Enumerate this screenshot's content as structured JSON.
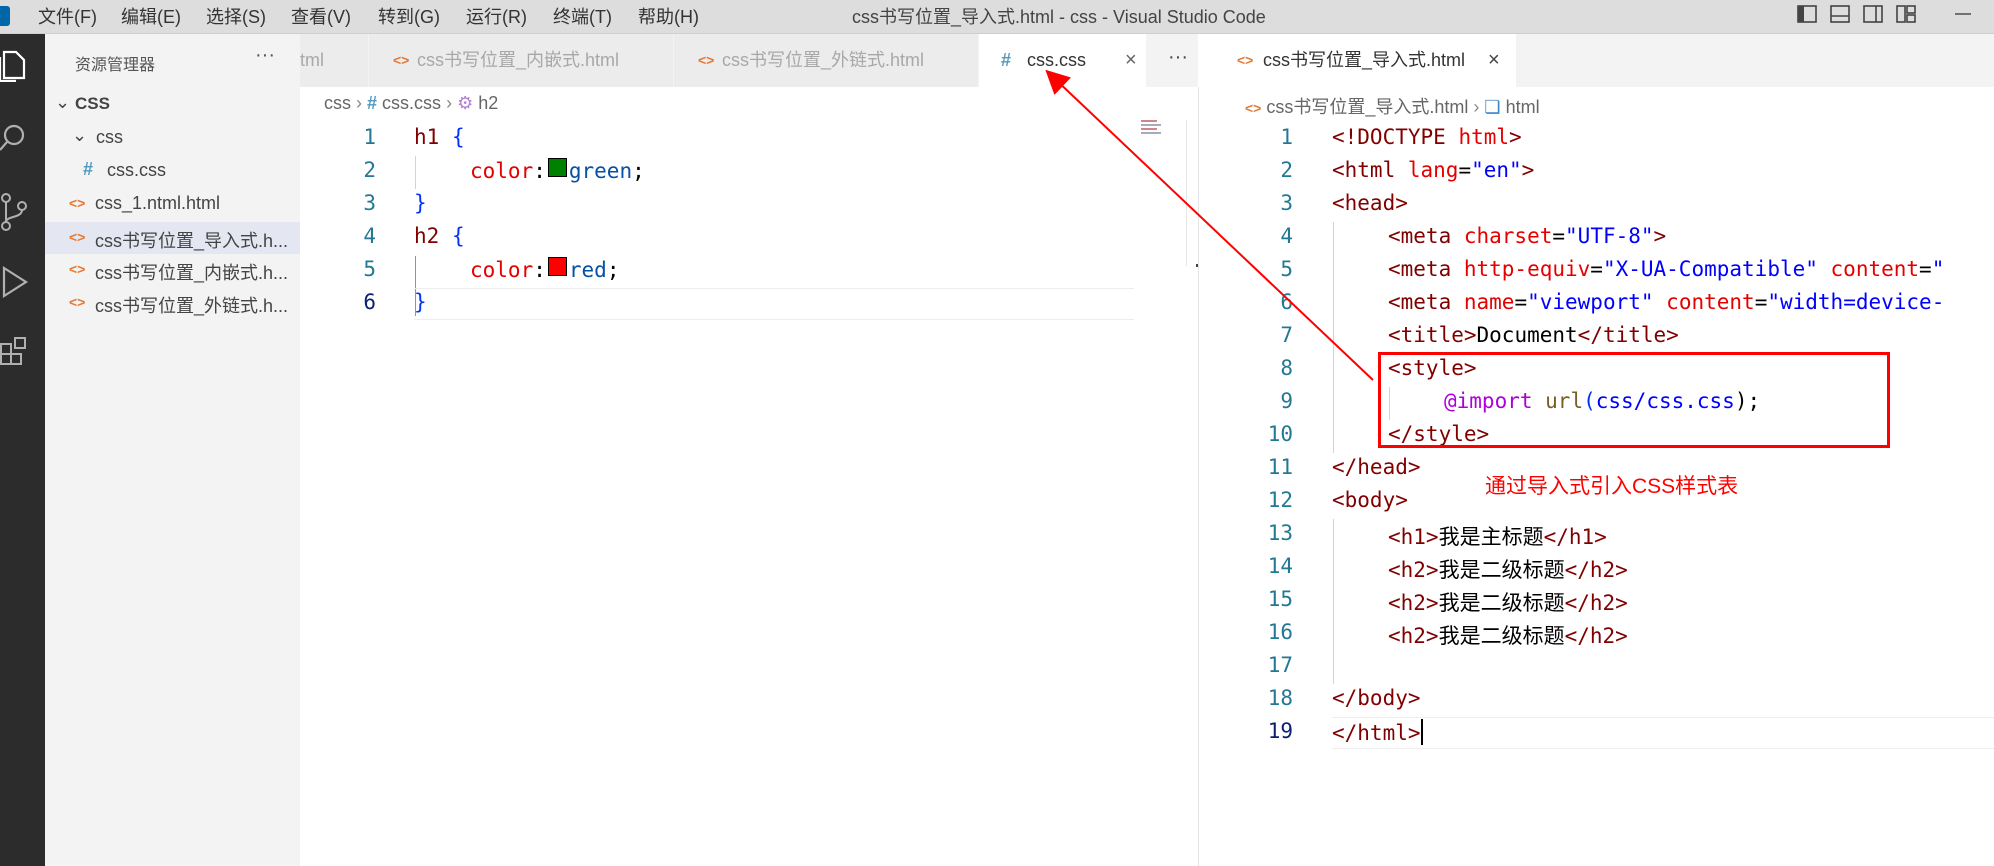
{
  "window": {
    "title": "css书写位置_导入式.html - css - Visual Studio Code"
  },
  "menu": [
    "文件(F)",
    "编辑(E)",
    "选择(S)",
    "查看(V)",
    "转到(G)",
    "运行(R)",
    "终端(T)",
    "帮助(H)"
  ],
  "sidebar": {
    "title": "资源管理器",
    "more": "···",
    "root": "CSS",
    "folder": "css",
    "file_in_folder": "css.css",
    "files": [
      "css_1.ntml.html",
      "css书写位置_导入式.h...",
      "css书写位置_内嵌式.h...",
      "css书写位置_外链式.h..."
    ]
  },
  "left_editor": {
    "tabs": [
      "tml",
      "css书写位置_内嵌式.html",
      "css书写位置_外链式.html"
    ],
    "active_tab": "css.css",
    "tabs_more": "···",
    "breadcrumb": [
      "css",
      "css.css",
      "h2"
    ],
    "line_numbers": [
      "1",
      "2",
      "3",
      "4",
      "5",
      "6"
    ],
    "code": {
      "l1_sel": "h1",
      "l1_brace": "{",
      "l2_prop": "color",
      "l2_colon": ":",
      "l2_val": "green",
      "l2_semi": ";",
      "l3": "}",
      "l4_sel": "h2",
      "l4_brace": "{",
      "l5_prop": "color",
      "l5_colon": ":",
      "l5_val": "red",
      "l5_semi": ";",
      "l6": "}"
    },
    "swatch_colors": [
      "#008000",
      "#ff0000"
    ]
  },
  "right_editor": {
    "tab": "css书写位置_导入式.html",
    "breadcrumb": [
      "css书写位置_导入式.html",
      "html"
    ],
    "line_numbers": [
      "1",
      "2",
      "3",
      "4",
      "5",
      "6",
      "7",
      "8",
      "9",
      "10",
      "11",
      "12",
      "13",
      "14",
      "15",
      "16",
      "17",
      "18",
      "19"
    ],
    "code": {
      "l1a": "<!DOCTYPE",
      "l1b": " html",
      "l1c": ">",
      "l2a": "<html",
      "l2b": " lang",
      "l2c": "=",
      "l2d": "\"en\"",
      "l2e": ">",
      "l3": "<head>",
      "l4a": "<meta",
      "l4b": " charset",
      "l4c": "=",
      "l4d": "\"UTF-8\"",
      "l4e": ">",
      "l5a": "<meta",
      "l5b": " http-equiv",
      "l5c": "=",
      "l5d": "\"X-UA-Compatible\"",
      "l5e": " content",
      "l5f": "=",
      "l5g": "\"",
      "l6a": "<meta",
      "l6b": " name",
      "l6c": "=",
      "l6d": "\"viewport\"",
      "l6e": " content",
      "l6f": "=",
      "l6g": "\"width=device-",
      "l7a": "<title>",
      "l7b": "Document",
      "l7c": "</title>",
      "l8": "<style>",
      "l9a": "@import",
      "l9b": " url",
      "l9c": "(",
      "l9d": "css/css.css",
      "l9e": ");",
      "l10": "</style>",
      "l11": "</head>",
      "l12": "<body>",
      "l13a": "<h1>",
      "l13b": "我是主标题",
      "l13c": "</h1>",
      "l14a": "<h2>",
      "l14b": "我是二级标题",
      "l14c": "</h2>",
      "l15a": "<h2>",
      "l15b": "我是二级标题",
      "l15c": "</h2>",
      "l16a": "<h2>",
      "l16b": "我是二级标题",
      "l16c": "</h2>",
      "l18": "</body>",
      "l19": "</html>"
    }
  },
  "annotation": {
    "text": "通过导入式引入CSS样式表",
    "color": "#ff0000"
  }
}
